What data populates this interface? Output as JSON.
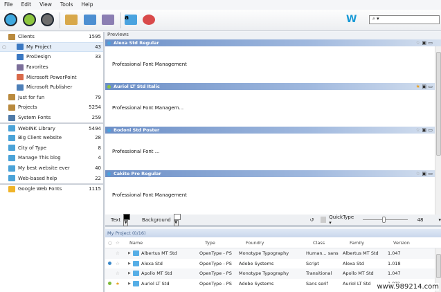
{
  "menu": [
    "File",
    "Edit",
    "View",
    "Tools",
    "Help"
  ],
  "toolbar": {
    "brand_logo": "W",
    "search_placeholder": "⌕ ▾",
    "circle_colors": [
      "#3fa9df",
      "#8dc63f",
      "#6d6d6d"
    ]
  },
  "sidebar": {
    "items": [
      {
        "label": "Clients",
        "count": "1595",
        "indent": 0,
        "icon": "#b98a3e"
      },
      {
        "label": "My Project",
        "count": "43",
        "indent": 1,
        "icon": "#3a78c2",
        "selected": true
      },
      {
        "label": "ProDesign",
        "count": "33",
        "indent": 1,
        "icon": "#3a78c2"
      },
      {
        "label": "Favorites",
        "count": "",
        "indent": 1,
        "icon": "#7b6e99"
      },
      {
        "label": "Microsoft PowerPoint",
        "count": "",
        "indent": 1,
        "icon": "#d9694a"
      },
      {
        "label": "Microsoft Publisher",
        "count": "",
        "indent": 1,
        "icon": "#4d7fb8"
      },
      {
        "label": "Just for fun",
        "count": "79",
        "indent": 0,
        "icon": "#b98a3e"
      },
      {
        "label": "Projects",
        "count": "5254",
        "indent": 0,
        "icon": "#b98a3e"
      },
      {
        "label": "System Fonts",
        "count": "259",
        "indent": 0,
        "icon": "#4f7aa8"
      },
      {
        "label": "WebINK Library",
        "count": "5494",
        "indent": 0,
        "icon": "#4ba3d8",
        "sep": true
      },
      {
        "label": "Big Client website",
        "count": "28",
        "indent": 0,
        "icon": "#4ba3d8"
      },
      {
        "label": "City of Type",
        "count": "8",
        "indent": 0,
        "icon": "#4ba3d8"
      },
      {
        "label": "Manage This blog",
        "count": "4",
        "indent": 0,
        "icon": "#4ba3d8"
      },
      {
        "label": "My best website ever",
        "count": "40",
        "indent": 0,
        "icon": "#4ba3d8"
      },
      {
        "label": "Web-based help",
        "count": "22",
        "indent": 0,
        "icon": "#4ba3d8"
      },
      {
        "label": "Google Web Fonts",
        "count": "1115",
        "indent": 0,
        "icon": "#f0b429",
        "sep": true
      }
    ]
  },
  "previews": {
    "title": "Previews",
    "items": [
      {
        "font": "Alexa Std Regular",
        "text": "Professional Font Management",
        "dot": "#4aa3df",
        "starred": false
      },
      {
        "font": "Auriol LT Std Italic",
        "text": "Professional Font Managem...",
        "dot": "#8dc63f",
        "starred": true
      },
      {
        "font": "Bodoni Std Poster",
        "text": "Professional Font ...",
        "dot": "#4aa3df",
        "starred": false
      },
      {
        "font": "Cakite Pro Regular",
        "text": "Professional Font Management",
        "dot": "#4aa3df",
        "starred": false
      }
    ]
  },
  "options": {
    "text_label": "Text",
    "background_label": "Background",
    "quicktype_label": "QuickType ▾",
    "size": "48",
    "text_color": "#000000",
    "background_color": "#ffffff"
  },
  "table": {
    "title": "My Project (0/16)",
    "columns": [
      "Name",
      "Type",
      "Foundry",
      "Class",
      "Family",
      "Version"
    ],
    "rows": [
      {
        "name": "Albertus MT Std",
        "type": "OpenType - PS",
        "foundry": "Monotype Typography",
        "class": "Human... sans",
        "family": "Albertus MT Std",
        "version": "1.047",
        "dot": "",
        "starred": false
      },
      {
        "name": "Alexa Std",
        "type": "OpenType - PS",
        "foundry": "Adobe Systems",
        "class": "Script",
        "family": "Alexa Std",
        "version": "1.018",
        "dot": "#3a88c9",
        "starred": false
      },
      {
        "name": "Apollo MT Std",
        "type": "OpenType - PS",
        "foundry": "Monotype Typography",
        "class": "Transitional",
        "family": "Apollo MT Std",
        "version": "1.047",
        "dot": "",
        "starred": false
      },
      {
        "name": "Auriol LT Std",
        "type": "OpenType - PS",
        "foundry": "Adobe Systems",
        "class": "Sans serif",
        "family": "Auriol LT Std",
        "version": "1.0??",
        "dot": "#7dbb3a",
        "starred": true
      }
    ]
  },
  "watermark": "www.989214.com"
}
